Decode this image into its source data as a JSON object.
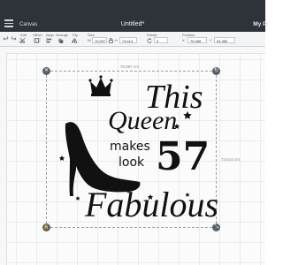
{
  "titlebar": {
    "canvas_label": "Canvas",
    "doc_title": "Untitled*",
    "project_label": "My Pr"
  },
  "toolbar": {
    "undo_label": "Undo",
    "redo_label": "Redo",
    "edit_label": "Edit",
    "offset_label": "Offset",
    "align_label": "Align",
    "arrange_label": "Arrange",
    "flip_label": "Flip",
    "size_label": "Size",
    "width_prefix": "W",
    "width_value": "70.097",
    "height_prefix": "H",
    "height_value": "74.614",
    "rotate_label": "Rotate",
    "rotate_value": "0",
    "position_label": "Position",
    "x_prefix": "X",
    "x_value": "76.368",
    "y_prefix": "Y",
    "y_value": "94.380"
  },
  "canvas": {
    "width_dimension": "70.097 cm",
    "height_dimension": "74.614 cm"
  },
  "design": {
    "word_this": "This",
    "word_queen": "Queen",
    "word_makes": "makes",
    "word_look": "look",
    "number": "57",
    "word_fabulous": "Fabulous"
  },
  "handles": {
    "close_glyph": "✕",
    "rotate_glyph": "↻",
    "lock_glyph": "🔒",
    "resize_glyph": "⤡"
  },
  "colors": {
    "titlebar": "#2e333a",
    "toolbar": "#f3f4f6",
    "design_ink": "#111111"
  }
}
